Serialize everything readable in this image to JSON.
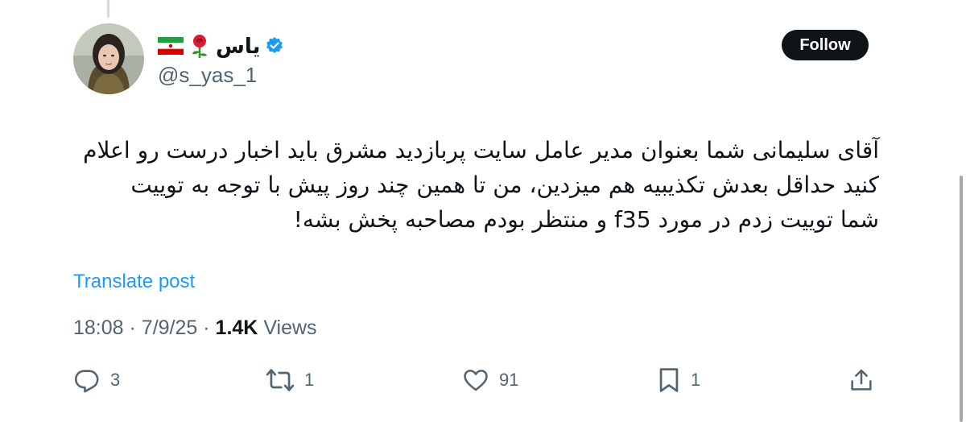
{
  "author": {
    "display_name": "یاس",
    "handle": "@s_yas_1",
    "flag_icon": "iran-flag-icon",
    "emoji_icon": "red-rose-icon",
    "verified_icon": "verified-badge-icon",
    "verified_color": "#1d9bf0"
  },
  "follow_button": {
    "label": "Follow"
  },
  "tweet": {
    "lines": [
      "آقای سلیمانی شما بعنوان مدیر عامل سایت پربازدید مشرق باید اخبار درست رو اعلام",
      "کنید  حداقل بعدش تکذیبیه هم میزدین،  من تا همین چند روز پیش با توجه به توییت",
      "شما توییت زدم در مورد f35 و منتظر بودم مصاحبه پخش بشه!"
    ],
    "translate_label": "Translate post"
  },
  "meta": {
    "time": "18:08",
    "date": "7/9/25",
    "separator": "·",
    "views_count": "1.4K",
    "views_label": "Views"
  },
  "actions": {
    "reply": {
      "icon": "reply-icon",
      "count": "3"
    },
    "repost": {
      "icon": "repost-icon",
      "count": "1"
    },
    "like": {
      "icon": "heart-icon",
      "count": "91"
    },
    "bookmark": {
      "icon": "bookmark-icon",
      "count": "1"
    },
    "share": {
      "icon": "share-icon"
    }
  },
  "colors": {
    "text_primary": "#0f1419",
    "text_secondary": "#536471",
    "link": "#1d9bf0",
    "follow_bg": "#0f1419"
  }
}
